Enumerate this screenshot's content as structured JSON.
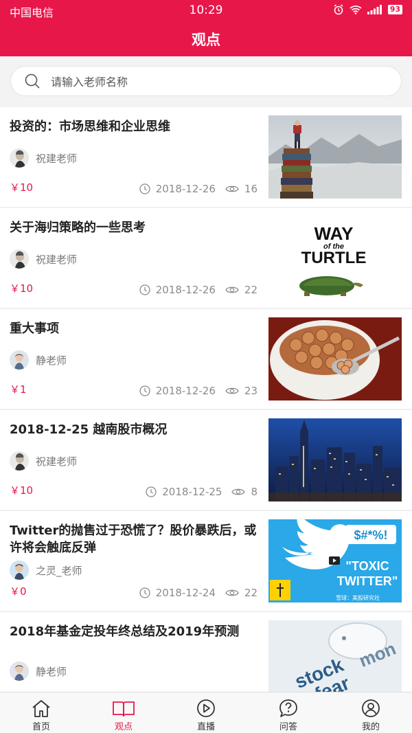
{
  "status": {
    "carrier": "中国电信",
    "time": "10:29",
    "battery": "93"
  },
  "header": {
    "title": "观点"
  },
  "search": {
    "placeholder": "请输入老师名称"
  },
  "articles": [
    {
      "title": "投资的：市场思维和企业思维",
      "author": "祝建老师",
      "price": "￥10",
      "date": "2018-12-26",
      "views": "16",
      "image": "mountain-books"
    },
    {
      "title": "关于海归策略的一些思考",
      "author": "祝建老师",
      "price": "￥10",
      "date": "2018-12-26",
      "views": "22",
      "image": "way-of-the-turtle",
      "image_text": {
        "line1": "WAY",
        "line2": "of the",
        "line3": "TURTLE"
      }
    },
    {
      "title": "重大事项",
      "author": "静老师",
      "price": "￥1",
      "date": "2018-12-26",
      "views": "23",
      "image": "coins-bowl"
    },
    {
      "title": "2018-12-25 越南股市概况",
      "author": "祝建老师",
      "price": "￥10",
      "date": "2018-12-25",
      "views": "8",
      "image": "city-skyline"
    },
    {
      "title": "Twitter的抛售过于恐慌了？股价暴跌后，或许将会触底反弹",
      "author": "之灵_老师",
      "price": "￥0",
      "date": "2018-12-24",
      "views": "22",
      "image": "toxic-twitter",
      "image_text": {
        "bubble": "$#*%!",
        "toxic": "\"TOXIC",
        "twitter": "TWITTER\"",
        "credit": "雪球：美股研究社"
      }
    },
    {
      "title": "2018年基金定投年终总结及2019年预测",
      "author": "静老师",
      "price": "",
      "date": "",
      "views": "",
      "image": "piggy-stock",
      "image_text": {
        "word1": "stock",
        "word2": "fear",
        "word3": "mon"
      }
    }
  ],
  "tabs": [
    {
      "label": "首页",
      "icon": "home-icon"
    },
    {
      "label": "观点",
      "icon": "book-icon",
      "active": true
    },
    {
      "label": "直播",
      "icon": "play-icon"
    },
    {
      "label": "问答",
      "icon": "question-icon"
    },
    {
      "label": "我的",
      "icon": "user-icon"
    }
  ],
  "colors": {
    "brand": "#e8174a",
    "price": "#e8174a",
    "meta": "#8a8a8a"
  }
}
